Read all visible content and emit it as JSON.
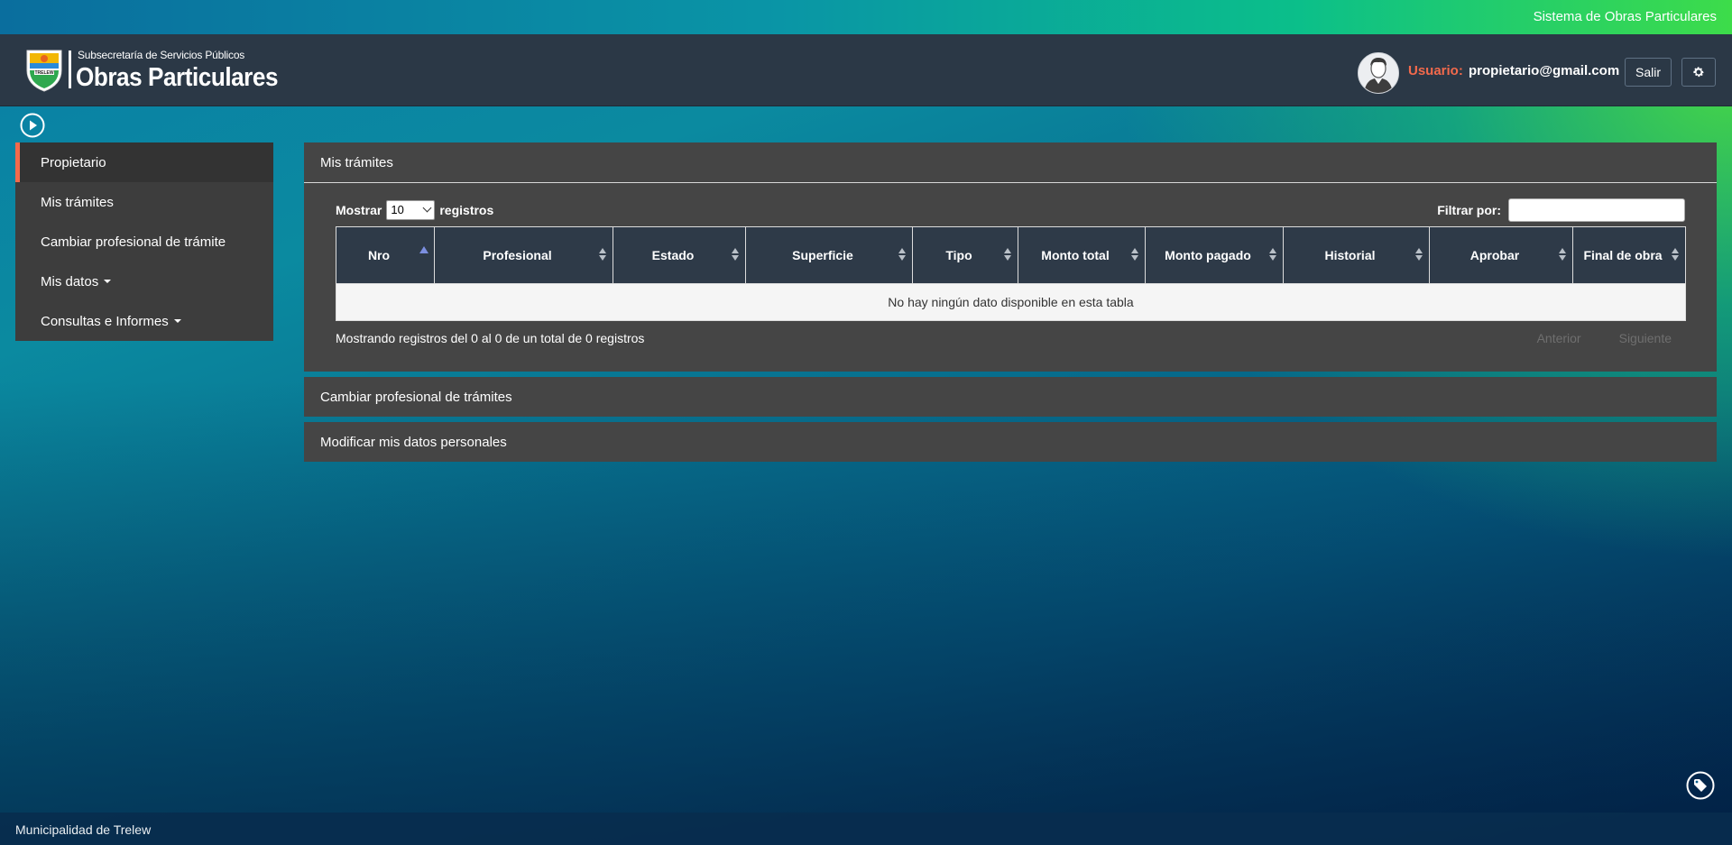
{
  "topbar": {
    "system_title": "Sistema de Obras Particulares"
  },
  "header": {
    "logo": {
      "subtitle": "Subsecretaría de Servicios Públicos",
      "title": "Obras Particulares",
      "shield_text": "TRELEW"
    },
    "user": {
      "label": "Usuario:",
      "email": "propietario@gmail.com"
    },
    "logout_label": "Salir",
    "settings_icon": "gear-icon"
  },
  "sidebar": {
    "toggle_icon": "play-circle-icon",
    "items": [
      {
        "label": "Propietario",
        "active": true
      },
      {
        "label": "Mis trámites"
      },
      {
        "label": "Cambiar profesional de trámite"
      },
      {
        "label": "Mis datos",
        "dropdown": true
      },
      {
        "label": "Consultas e Informes",
        "dropdown": true
      }
    ]
  },
  "panels": {
    "mis_tramites": {
      "title": "Mis trámites",
      "length": {
        "prefix": "Mostrar",
        "value": "10",
        "suffix": "registros"
      },
      "filter_label": "Filtrar por:",
      "columns": [
        "Nro",
        "Profesional",
        "Estado",
        "Superficie",
        "Tipo",
        "Monto total",
        "Monto pagado",
        "Historial",
        "Aprobar",
        "Final de obra"
      ],
      "empty_message": "No hay ningún dato disponible en esta tabla",
      "info": "Mostrando registros del 0 al 0 de un total de 0 registros",
      "prev_label": "Anterior",
      "next_label": "Siguiente"
    },
    "cambiar_profesional": {
      "title": "Cambiar profesional de trámites"
    },
    "modificar_datos": {
      "title": "Modificar mis datos personales"
    }
  },
  "footer": {
    "text": "Municipalidad de Trelew"
  },
  "colors": {
    "accent": "#f36a4c",
    "header_bg": "#2b3846",
    "panel_bg": "#454545"
  }
}
